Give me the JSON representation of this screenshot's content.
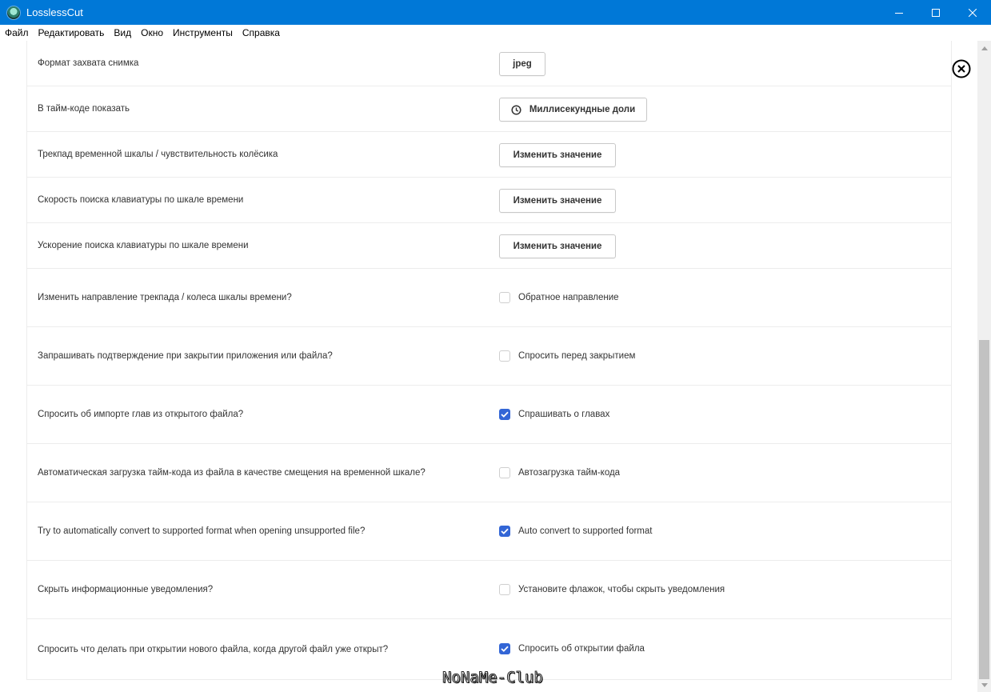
{
  "window": {
    "title": "LosslessCut"
  },
  "menu": [
    {
      "label": "Файл"
    },
    {
      "label": "Редактировать"
    },
    {
      "label": "Вид"
    },
    {
      "label": "Окно"
    },
    {
      "label": "Инструменты"
    },
    {
      "label": "Справка"
    }
  ],
  "settings": [
    {
      "label": "Формат захвата снимка",
      "control": "button",
      "button_label": "jpeg"
    },
    {
      "label": "В тайм-коде показать",
      "control": "button",
      "icon": "clock-icon",
      "button_label": "Миллисекундные доли"
    },
    {
      "label": "Трекпад временной шкалы / чувствительность колёсика",
      "control": "button",
      "button_label": "Изменить значение"
    },
    {
      "label": "Скорость поиска клавиатуры по шкале времени",
      "control": "button",
      "button_label": "Изменить значение"
    },
    {
      "label": "Ускорение поиска клавиатуры по шкале времени",
      "control": "button",
      "button_label": "Изменить значение"
    },
    {
      "label": "Изменить направление трекпада / колеса шкалы времени?",
      "control": "checkbox",
      "checked": false,
      "checkbox_label": "Обратное направление"
    },
    {
      "label": "Запрашивать подтверждение при закрытии приложения или файла?",
      "control": "checkbox",
      "checked": false,
      "checkbox_label": "Спросить перед закрытием"
    },
    {
      "label": "Спросить об импорте глав из открытого файла?",
      "control": "checkbox",
      "checked": true,
      "checkbox_label": "Спрашивать о главах"
    },
    {
      "label": "Автоматическая загрузка тайм-кода из файла в качестве смещения на временной шкале?",
      "control": "checkbox",
      "checked": false,
      "checkbox_label": "Автозагрузка тайм-кода"
    },
    {
      "label": "Try to automatically convert to supported format when opening unsupported file?",
      "control": "checkbox",
      "checked": true,
      "checkbox_label": "Auto convert to supported format"
    },
    {
      "label": "Скрыть информационные уведомления?",
      "control": "checkbox",
      "checked": false,
      "checkbox_label": "Установите флажок, чтобы скрыть уведомления"
    },
    {
      "label": "Спросить что делать при открытии нового файла, когда другой файл уже открыт?",
      "control": "checkbox",
      "checked": true,
      "checkbox_label": "Спросить об открытии файла"
    }
  ],
  "watermark": "NoNaMe-Club",
  "colors": {
    "titlebar": "#0078d7",
    "accent": "#3366d6"
  }
}
